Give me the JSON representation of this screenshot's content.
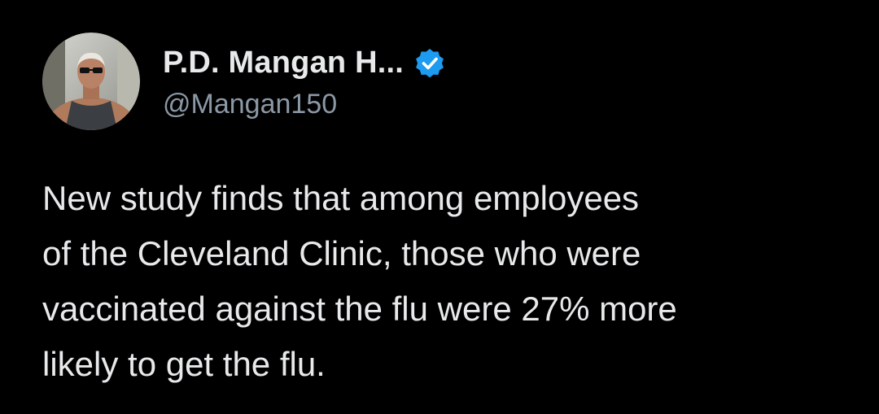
{
  "colors": {
    "background": "#000000",
    "primary_text": "#e7e9ea",
    "secondary_text": "#8b98a5",
    "verified_badge": "#1d9bf0"
  },
  "author": {
    "display_name": "P.D. Mangan H...",
    "handle": "@Mangan150",
    "verified_icon": "verified-badge-icon",
    "avatar_icon": "avatar-photo"
  },
  "tweet": {
    "text_lines": [
      "New study finds that among employees",
      "of the Cleveland Clinic, those who were",
      "vaccinated against the flu were 27% more",
      "likely to get the flu."
    ]
  }
}
